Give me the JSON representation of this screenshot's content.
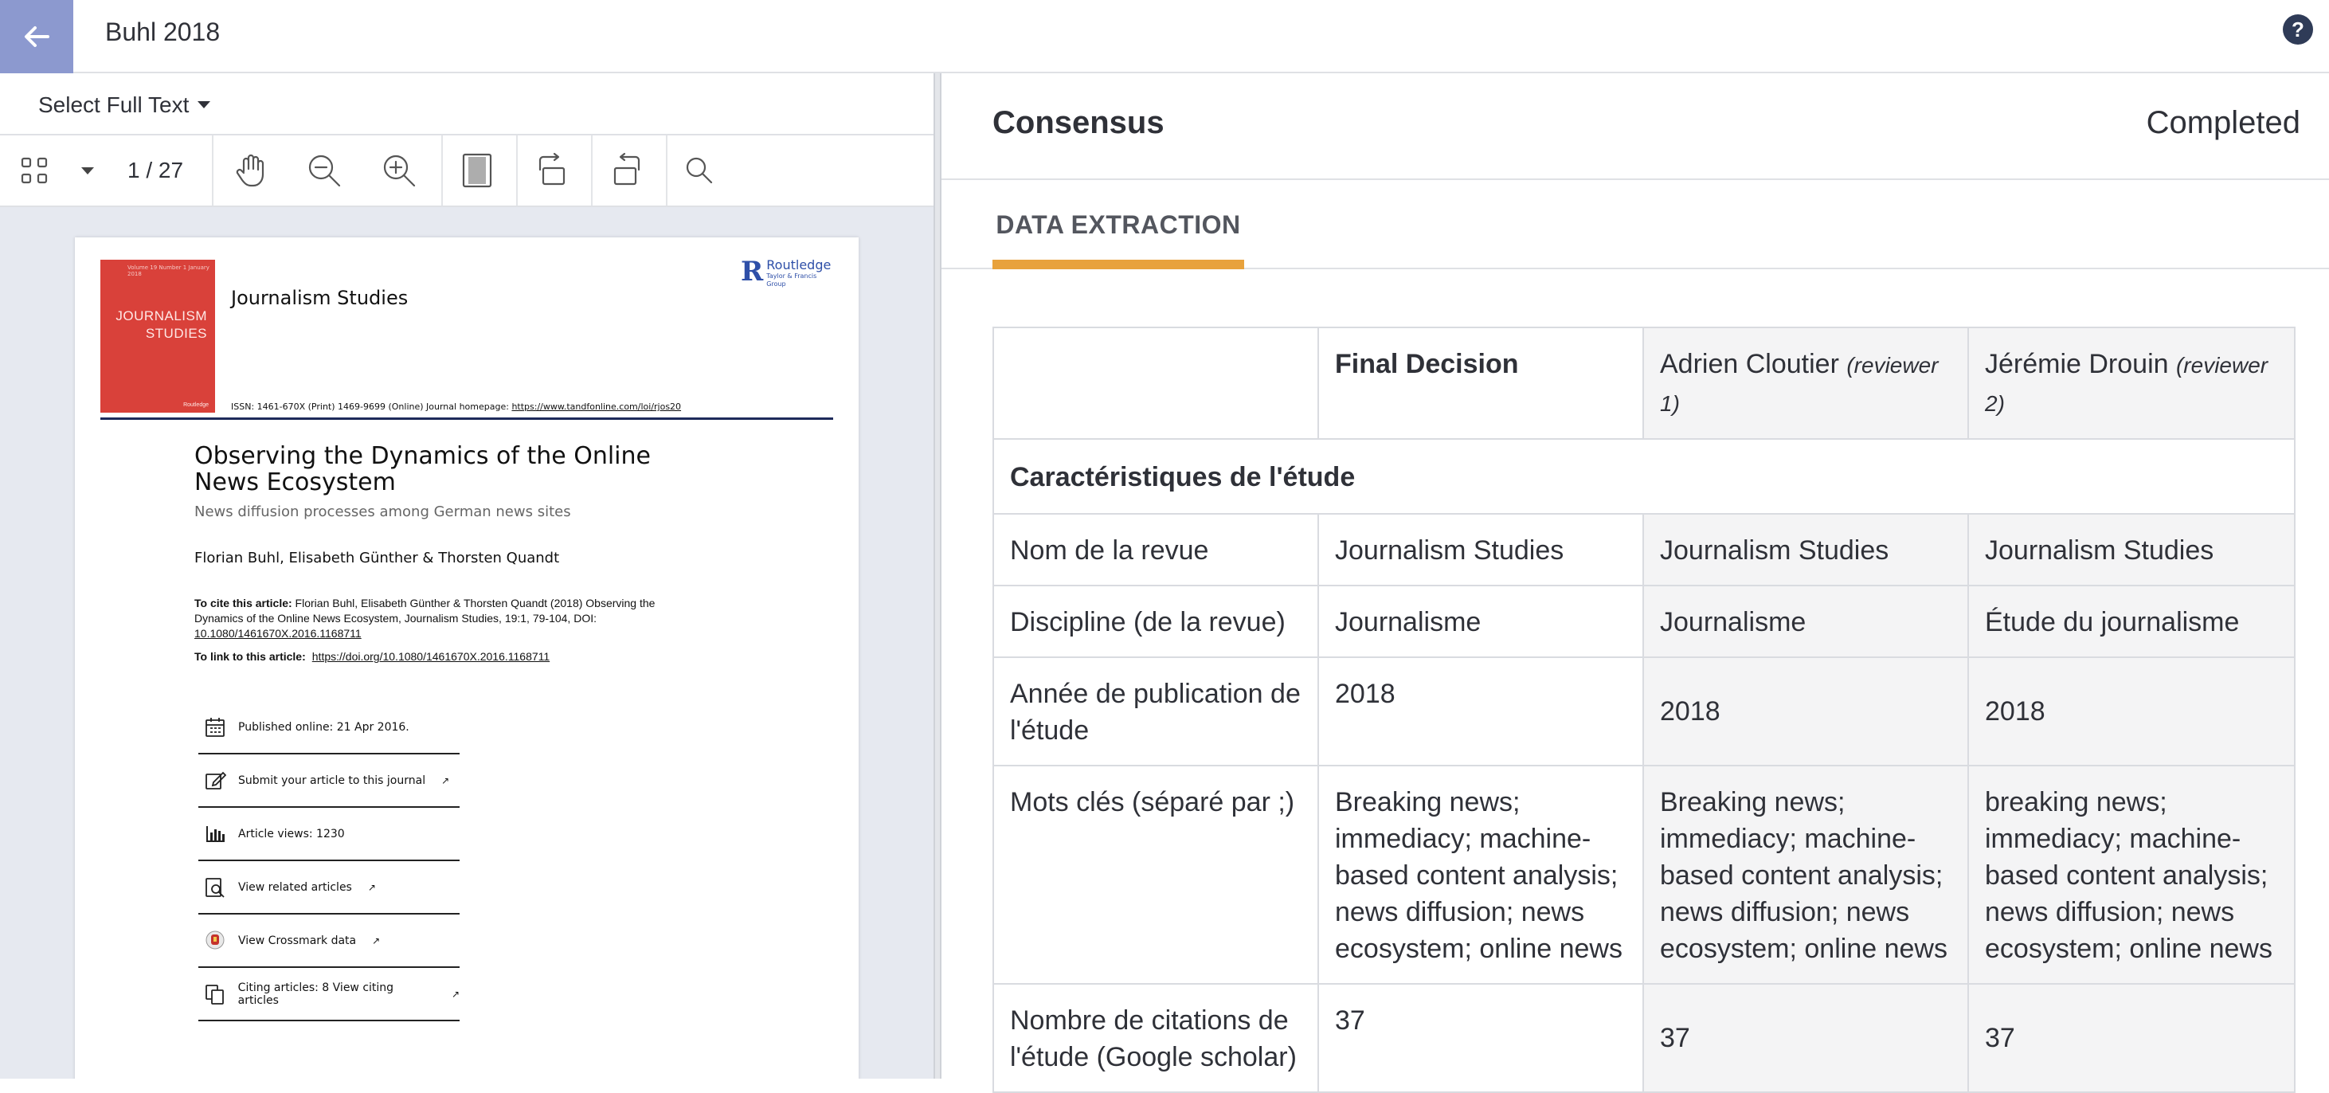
{
  "header": {
    "title": "Buhl 2018"
  },
  "left_pane": {
    "select_full_text": "Select Full Text",
    "page_indicator": "1 / 27",
    "pdf": {
      "cover_journal_small": "Volume 19 Number 1 January 2018",
      "cover_title": "JOURNALISM STUDIES",
      "cover_publisher": "Routledge",
      "journal_name": "Journalism Studies",
      "publisher_name": "Routledge",
      "publisher_sub": "Taylor & Francis Group",
      "issn": "ISSN: 1461-670X (Print) 1469-9699 (Online) Journal homepage: ",
      "homepage_url": "https://www.tandfonline.com/loi/rjos20",
      "article_title": "Observing the Dynamics of the Online News Ecosystem",
      "article_subtitle": "News diffusion processes among German news sites",
      "authors": "Florian Buhl, Elisabeth Günther & Thorsten Quandt",
      "cite_label": "To cite this article:",
      "cite_text": " Florian Buhl, Elisabeth Günther & Thorsten Quandt (2018) Observing the Dynamics of the Online News Ecosystem, Journalism Studies, 19:1, 79-104, DOI:",
      "cite_doi": "10.1080/1461670X.2016.1168711",
      "link_label": "To link to this article:",
      "link_url": "https://doi.org/10.1080/1461670X.2016.1168711",
      "info_items": [
        {
          "text": "Published online: 21 Apr 2016.",
          "icon": "calendar-icon"
        },
        {
          "text": "Submit your article to this journal",
          "icon": "edit-icon"
        },
        {
          "text": "Article views: 1230",
          "icon": "bar-chart-icon"
        },
        {
          "text": "View related articles",
          "icon": "related-search-icon"
        },
        {
          "text": "View Crossmark data",
          "icon": "crossmark-icon"
        },
        {
          "text": "Citing articles: 8 View citing articles",
          "icon": "citing-articles-icon"
        }
      ]
    }
  },
  "right_pane": {
    "title": "Consensus",
    "status": "Completed",
    "tab": "DATA EXTRACTION",
    "table": {
      "headers": {
        "final": "Final Decision",
        "reviewer1_name": "Adrien Cloutier",
        "reviewer1_note": "(reviewer 1)",
        "reviewer2_name": "Jérémie Drouin",
        "reviewer2_note": "(reviewer 2)"
      },
      "section": "Caractéristiques de l'étude",
      "rows": [
        {
          "label": "Nom de la revue",
          "final": "Journalism Studies",
          "r1": "Journalism Studies",
          "r2": "Journalism Studies"
        },
        {
          "label": "Discipline (de la revue)",
          "final": "Journalisme",
          "r1": "Journalisme",
          "r2": "Étude du journalisme"
        },
        {
          "label": "Année de publication de l'étude",
          "final": "2018",
          "r1": "2018",
          "r2": "2018"
        },
        {
          "label": "Mots clés (séparé par ;)",
          "final": "Breaking news; immediacy; machine-based content analysis; news diffusion; news ecosystem; online news",
          "r1": "Breaking news; immediacy; machine-based content analysis; news diffusion; news ecosystem; online news",
          "r2": "breaking news; immediacy; machine-based content analysis; news diffusion; news ecosystem; online news"
        },
        {
          "label": "Nombre de citations de l'étude (Google scholar)",
          "final": "37",
          "r1": "37",
          "r2": "37"
        }
      ]
    }
  },
  "colors": {
    "back_button": "#8c99cf",
    "tab_underline": "#e8a23c",
    "help_icon": "#2f3b57",
    "cover": "#d9413a"
  }
}
